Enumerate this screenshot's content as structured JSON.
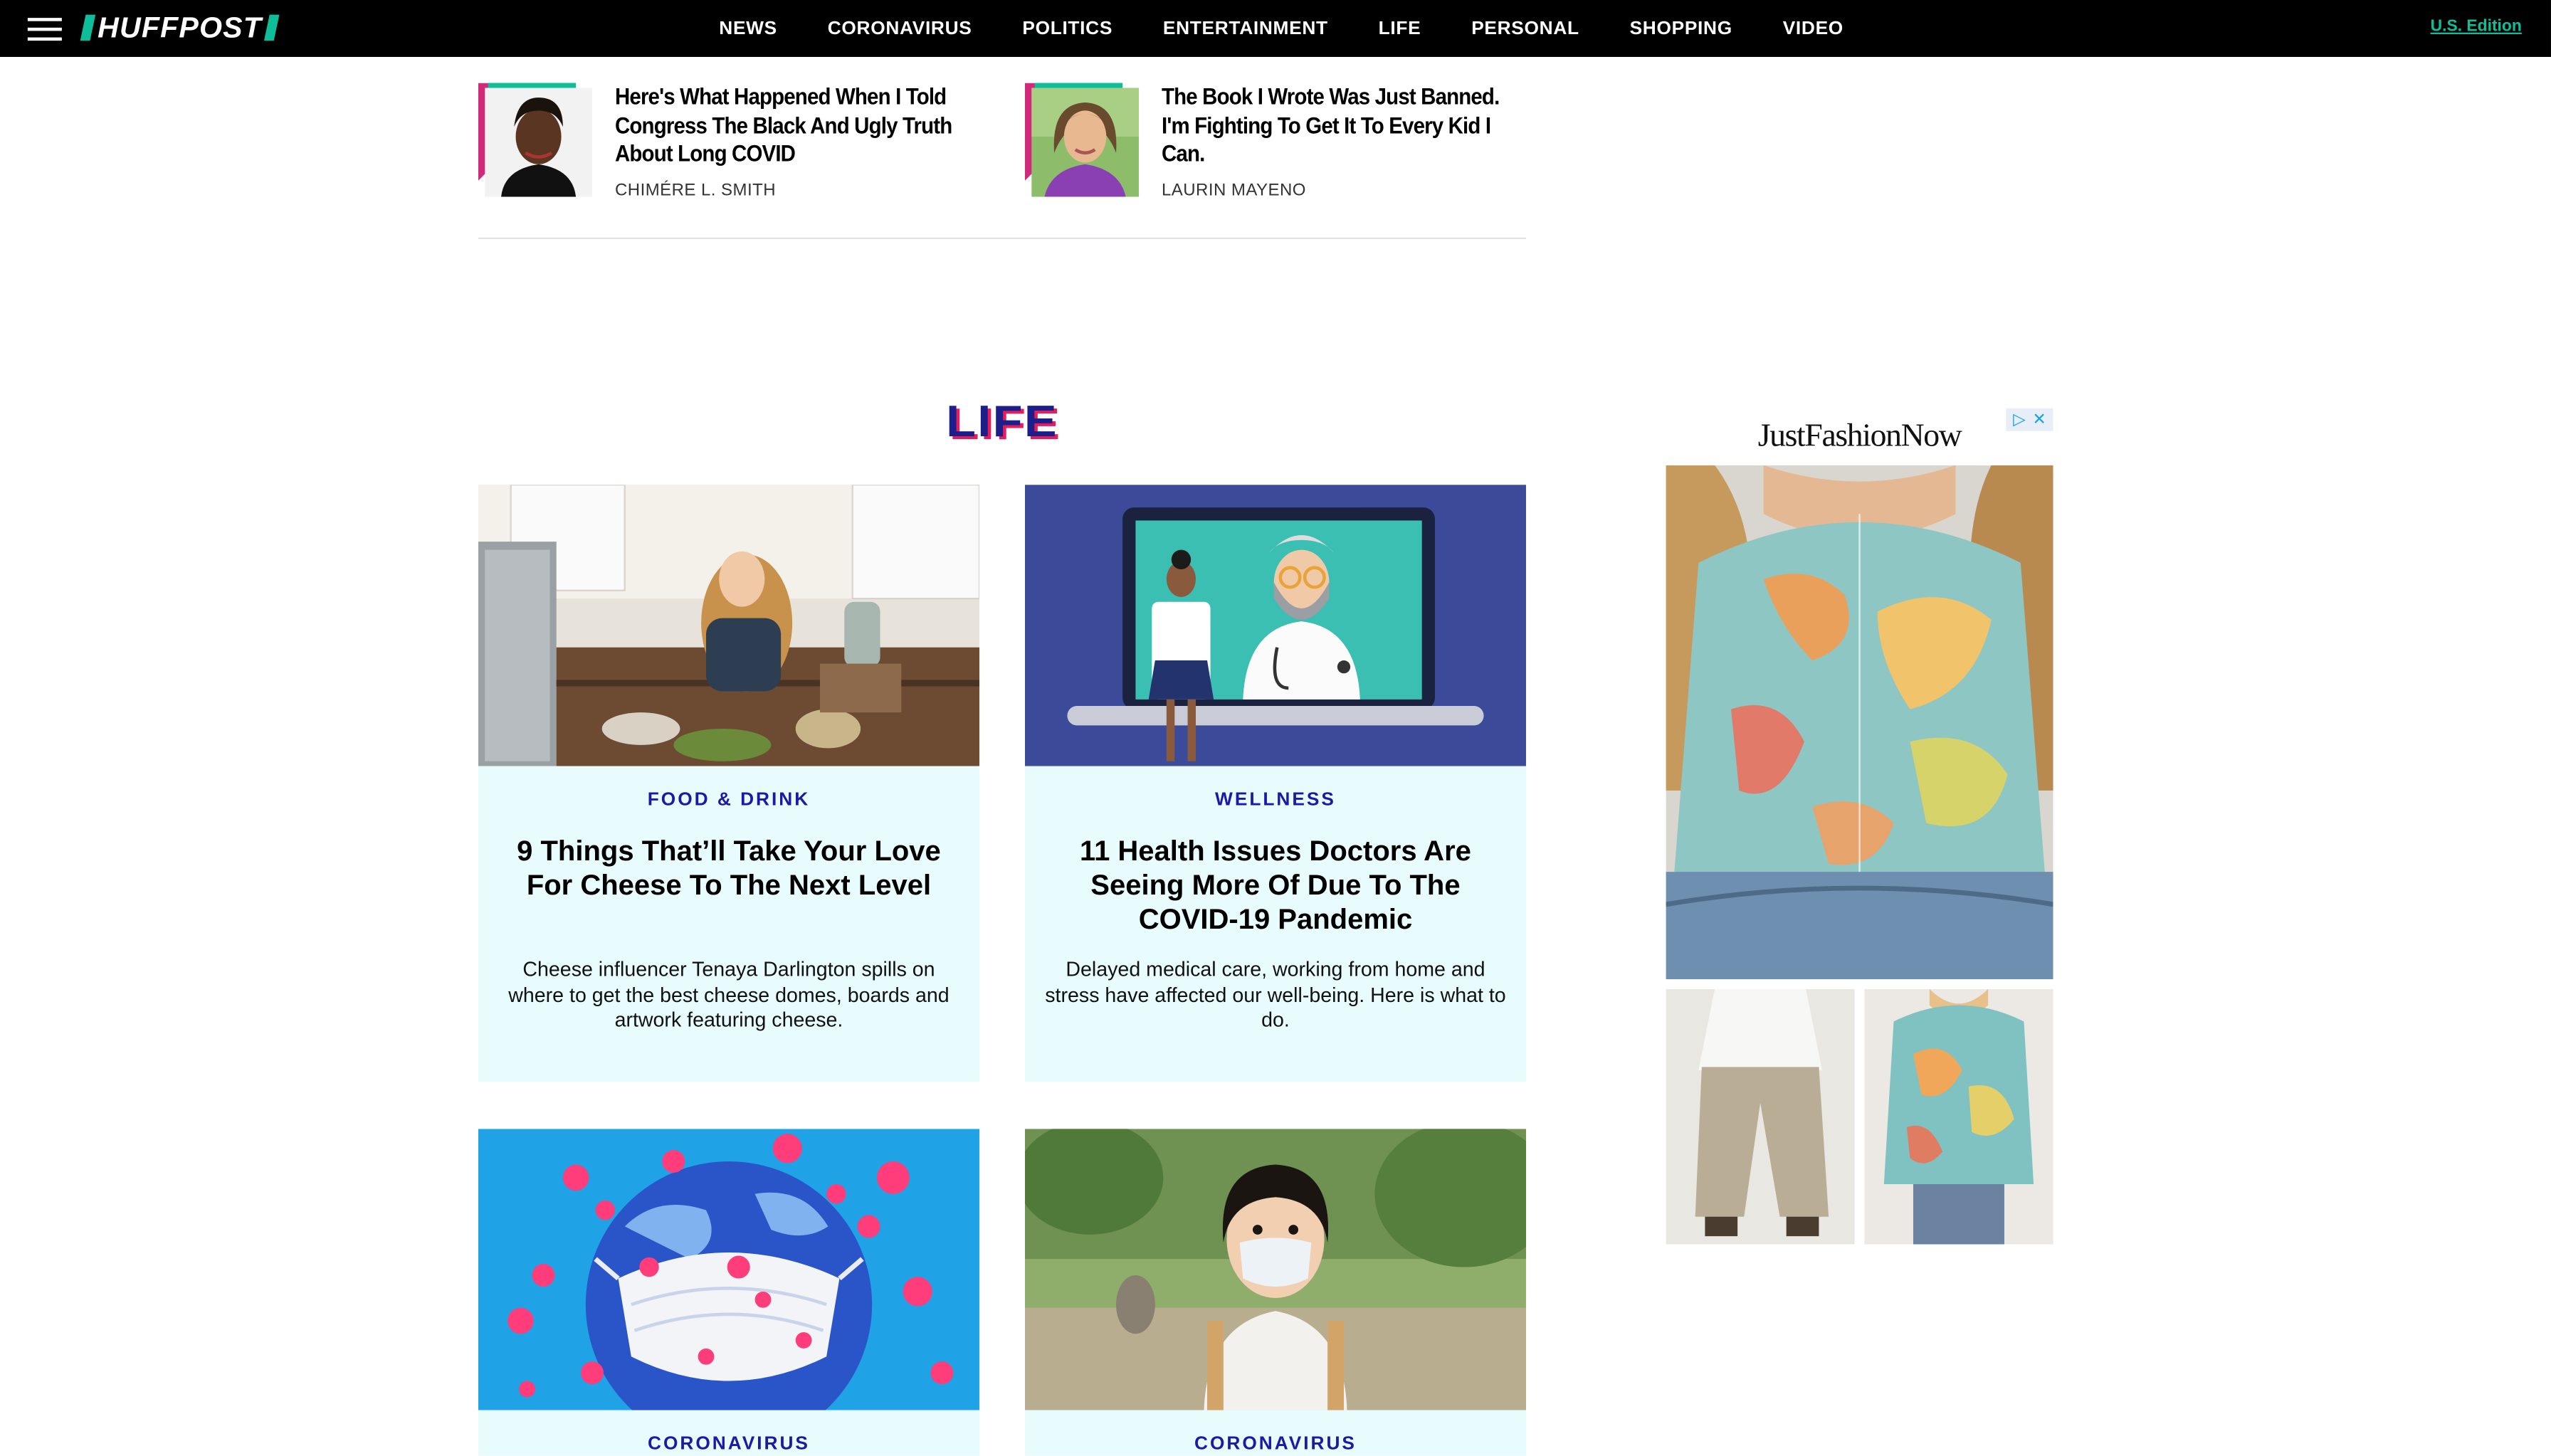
{
  "nav": {
    "logo": "HUFFPOST",
    "items": [
      "NEWS",
      "CORONAVIRUS",
      "POLITICS",
      "ENTERTAINMENT",
      "LIFE",
      "PERSONAL",
      "SHOPPING",
      "VIDEO"
    ],
    "edition": "U.S. Edition"
  },
  "opinion": [
    {
      "headline": "Here's What Happened When I Told Congress The Black And Ugly Truth About Long COVID",
      "author": "CHIMÉRE L. SMITH"
    },
    {
      "headline": "The Book I Wrote Was Just Banned. I'm Fighting To Get It To Every Kid I Can.",
      "author": "LAURIN MAYENO"
    }
  ],
  "section_title": "LIFE",
  "cards": [
    {
      "section": "FOOD & DRINK",
      "title": "9 Things That’ll Take Your Love For Cheese To The Next Level",
      "dek": "Cheese influencer Tenaya Darlington spills on where to get the best cheese domes, boards and artwork featuring cheese."
    },
    {
      "section": "WELLNESS",
      "title": "11 Health Issues Doctors Are Seeing More Of Due To The COVID-19 Pandemic",
      "dek": "Delayed medical care, working from home and stress have affected our well-being. Here is what to do."
    },
    {
      "section": "CORONAVIRUS"
    },
    {
      "section": "CORONAVIRUS"
    }
  ],
  "ad": {
    "brand": "JustFashionNow"
  },
  "colors": {
    "accent": "#0dbe98",
    "section_link": "#1a1aa8",
    "card_bg": "#e8fbfd",
    "nav_bg": "#000000"
  }
}
